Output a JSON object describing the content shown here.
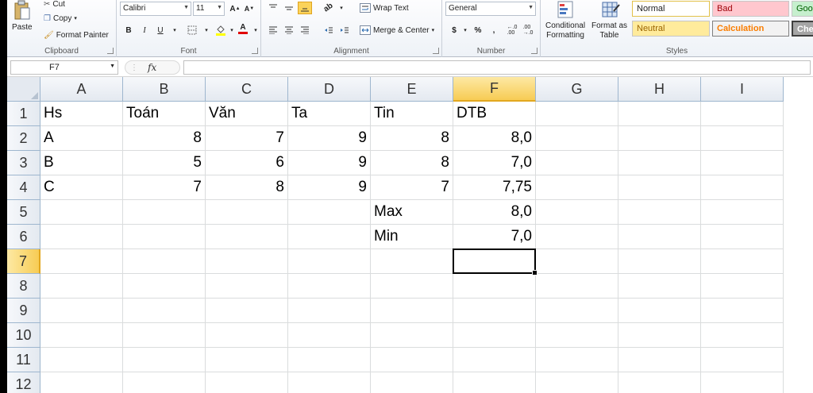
{
  "ribbon": {
    "clipboard": {
      "paste": "Paste",
      "cut": "Cut",
      "copy": "Copy",
      "format_painter": "Format Painter",
      "label": "Clipboard"
    },
    "font": {
      "name": "Calibri",
      "size": "11",
      "bold": "B",
      "italic": "I",
      "underline": "U",
      "label": "Font"
    },
    "alignment": {
      "wrap_text": "Wrap Text",
      "merge_center": "Merge & Center",
      "label": "Alignment"
    },
    "number": {
      "format": "General",
      "currency": "$",
      "percent": "%",
      "comma": ",",
      "label": "Number"
    },
    "styles": {
      "conditional_1": "Conditional",
      "conditional_2": "Formatting",
      "format_table_1": "Format as",
      "format_table_2": "Table",
      "normal": "Normal",
      "bad": "Bad",
      "good": "Good",
      "neutral": "Neutral",
      "calculation": "Calculation",
      "check": "Check",
      "label": "Styles"
    }
  },
  "formula_bar": {
    "name_box": "F7",
    "fx": "fx",
    "value": ""
  },
  "columns": [
    "A",
    "B",
    "C",
    "D",
    "E",
    "F",
    "G",
    "H",
    "I"
  ],
  "rows": [
    "1",
    "2",
    "3",
    "4",
    "5",
    "6",
    "7",
    "8",
    "9",
    "10",
    "11",
    "12"
  ],
  "active_cell": {
    "col": "F",
    "row": "7"
  },
  "cells": [
    [
      "Hs",
      "Toán",
      "Văn",
      "Ta",
      "Tin",
      "DTB",
      "",
      "",
      ""
    ],
    [
      "A",
      "8",
      "7",
      "9",
      "8",
      "8,0",
      "",
      "",
      ""
    ],
    [
      "B",
      "5",
      "6",
      "9",
      "8",
      "7,0",
      "",
      "",
      ""
    ],
    [
      "C",
      "7",
      "8",
      "9",
      "7",
      "7,75",
      "",
      "",
      ""
    ],
    [
      "",
      "",
      "",
      "",
      "Max",
      "8,0",
      "",
      "",
      ""
    ],
    [
      "",
      "",
      "",
      "",
      "Min",
      "7,0",
      "",
      "",
      ""
    ],
    [
      "",
      "",
      "",
      "",
      "",
      "",
      "",
      "",
      ""
    ],
    [
      "",
      "",
      "",
      "",
      "",
      "",
      "",
      "",
      ""
    ],
    [
      "",
      "",
      "",
      "",
      "",
      "",
      "",
      "",
      ""
    ],
    [
      "",
      "",
      "",
      "",
      "",
      "",
      "",
      "",
      ""
    ],
    [
      "",
      "",
      "",
      "",
      "",
      "",
      "",
      "",
      ""
    ],
    [
      "",
      "",
      "",
      "",
      "",
      "",
      "",
      "",
      ""
    ]
  ],
  "colors": {
    "active_header": "#f7cc54",
    "bad_bg": "#ffc7ce",
    "good_bg": "#c6efce",
    "neutral_bg": "#ffeb9c",
    "calc_text": "#fa7d00"
  }
}
